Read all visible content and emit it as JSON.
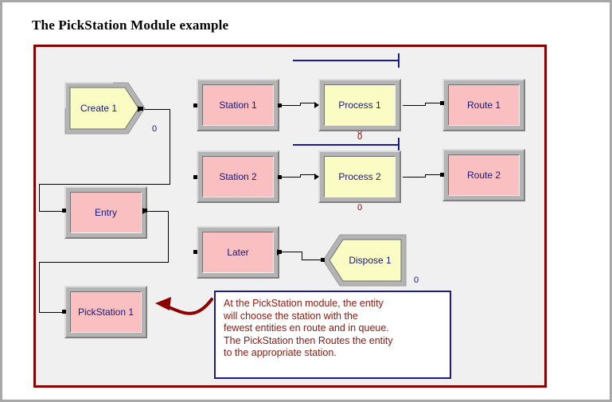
{
  "page": {
    "title": "The PickStation Module example"
  },
  "colors": {
    "frame_maroon": "#8b0000",
    "canvas_bg": "#f0f0f0",
    "block_pink": "#f9bfc1",
    "block_yellow": "#fbfbc4",
    "block_bevel": "#b4b4b4",
    "label_navy": "#181878",
    "queue_navy": "#1b1b8f",
    "callout_border": "#1b1b8f",
    "callout_text": "#8b1a10",
    "counter_red": "#8b0000",
    "window_border": "#a8a8a8"
  },
  "blocks": [
    {
      "id": "create1",
      "label": "Create 1",
      "shape": "pentagon-right",
      "fill": "yellow"
    },
    {
      "id": "station1",
      "label": "Station 1",
      "shape": "rectangle",
      "fill": "pink"
    },
    {
      "id": "process1",
      "label": "Process 1",
      "shape": "rectangle",
      "fill": "yellow"
    },
    {
      "id": "route1",
      "label": "Route 1",
      "shape": "rectangle",
      "fill": "pink"
    },
    {
      "id": "station2",
      "label": "Station 2",
      "shape": "rectangle",
      "fill": "pink"
    },
    {
      "id": "process2",
      "label": "Process 2",
      "shape": "rectangle",
      "fill": "yellow"
    },
    {
      "id": "route2",
      "label": "Route 2",
      "shape": "rectangle",
      "fill": "pink"
    },
    {
      "id": "entry",
      "label": "Entry",
      "shape": "rectangle",
      "fill": "pink"
    },
    {
      "id": "later",
      "label": "Later",
      "shape": "rectangle",
      "fill": "pink"
    },
    {
      "id": "dispose1",
      "label": "Dispose 1",
      "shape": "pentagon-left",
      "fill": "yellow"
    },
    {
      "id": "pickstation1",
      "label": "PickStation 1",
      "shape": "rectangle",
      "fill": "pink"
    }
  ],
  "counters": {
    "create1": "0",
    "process1_queue": "0",
    "process2_queue": "0",
    "process2_below": "0",
    "dispose1": "0"
  },
  "callout": {
    "lines": [
      "At the PickStation module, the entity",
      "will choose the station with the",
      "fewest entities en route and in queue.",
      "The PickStation then Routes the entity",
      "to the appropriate station."
    ]
  }
}
